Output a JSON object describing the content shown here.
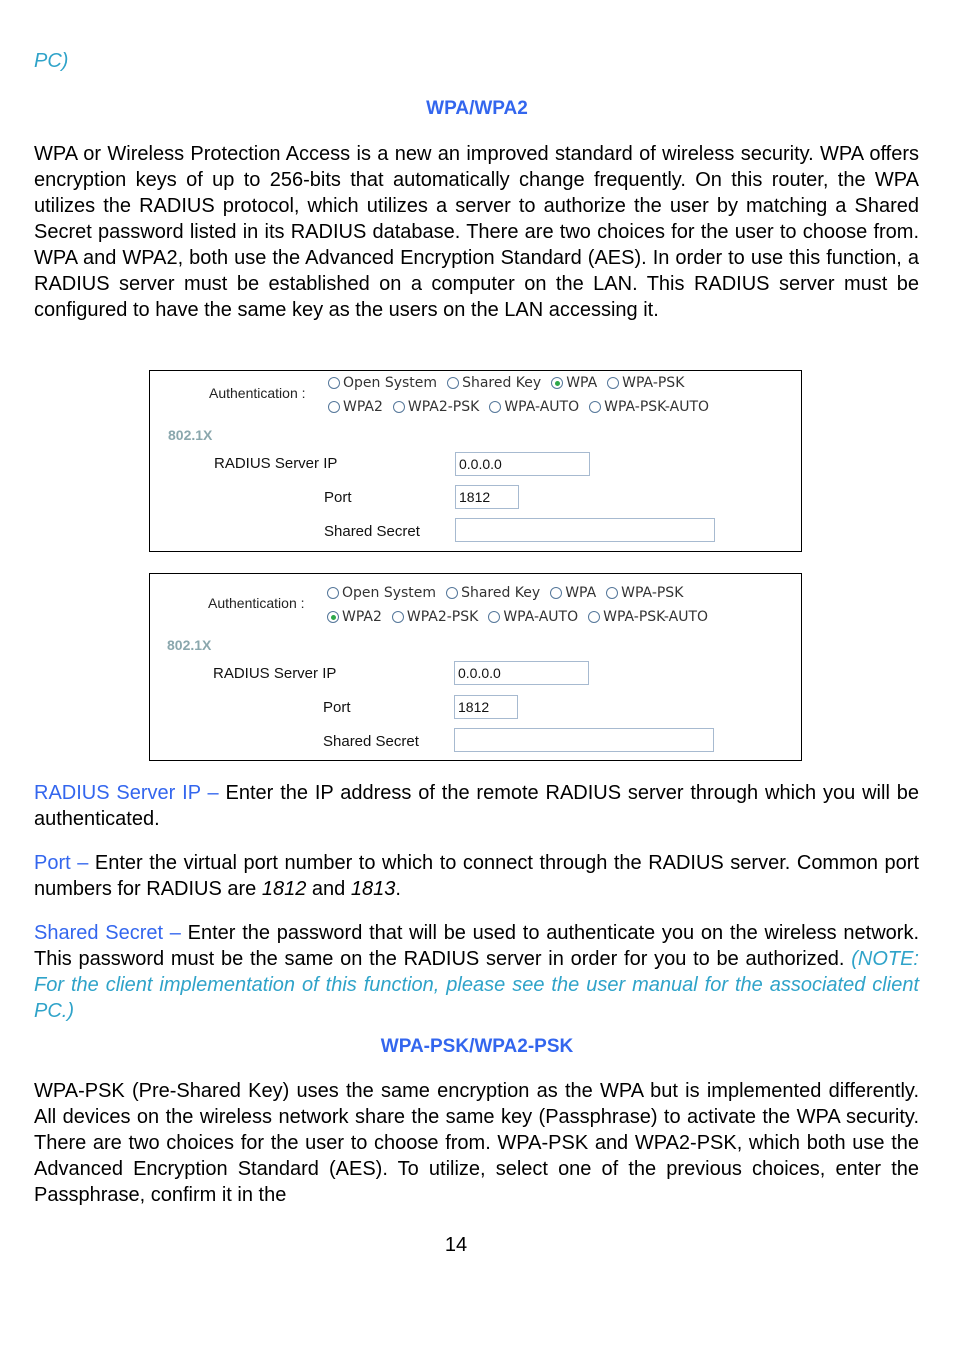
{
  "fragment_top": "PC)",
  "section1": {
    "heading": "WPA/WPA2",
    "body": "WPA or Wireless Protection Access is a new an improved standard of wireless security. WPA offers encryption keys of up to 256-bits that automatically change frequently. On this router, the WPA utilizes the RADIUS protocol, which utilizes a server to authorize the user by matching a Shared Secret password listed in its RADIUS database. There are two choices for the user to choose from. WPA and WPA2, both use the Advanced Encryption Standard (AES). In order to use this function, a RADIUS server must be established on a computer on the LAN. This RADIUS server must be configured to have the same key as the users on the LAN accessing it."
  },
  "panels": [
    {
      "auth_label": "Authentication :",
      "options_row1": [
        "Open System",
        "Shared Key",
        "WPA",
        "WPA-PSK"
      ],
      "options_row2": [
        "WPA2",
        "WPA2-PSK",
        "WPA-AUTO",
        "WPA-PSK-AUTO"
      ],
      "selected": "WPA",
      "section_label": "802.1X",
      "radius_ip_label": "RADIUS Server IP",
      "radius_ip_value": "0.0.0.0",
      "port_label": "Port",
      "port_value": "1812",
      "secret_label": "Shared Secret",
      "secret_value": ""
    },
    {
      "auth_label": "Authentication :",
      "options_row1": [
        "Open System",
        "Shared Key",
        "WPA",
        "WPA-PSK"
      ],
      "options_row2": [
        "WPA2",
        "WPA2-PSK",
        "WPA-AUTO",
        "WPA-PSK-AUTO"
      ],
      "selected": "WPA2",
      "section_label": "802.1X",
      "radius_ip_label": "RADIUS Server IP",
      "radius_ip_value": "0.0.0.0",
      "port_label": "Port",
      "port_value": "1812",
      "secret_label": "Shared Secret",
      "secret_value": ""
    }
  ],
  "definitions": {
    "radius_ip_term": "RADIUS Server IP –",
    "radius_ip_text": " Enter the IP address of the remote RADIUS server through which you will be authenticated.",
    "port_term": "Port –",
    "port_text_a": " Enter the virtual port number to which to connect through the RADIUS server. Common port numbers for RADIUS are ",
    "port_num1": "1812",
    "port_and": " and ",
    "port_num2": "1813",
    "port_end": ".",
    "secret_term": "Shared Secret –",
    "secret_text": " Enter the password that will be used to authenticate you on the wireless network. This password must be the same on the RADIUS server in order for you to be authorized. ",
    "secret_note": "(NOTE: For the client implementation of this function, please see the user manual for the associated client PC.)"
  },
  "section2": {
    "heading": "WPA-PSK/WPA2-PSK",
    "body": "WPA-PSK (Pre-Shared Key) uses the same encryption as the WPA but is implemented differently. All devices on the wireless network share the same key (Passphrase) to activate the WPA security. There are two choices for the user to choose from. WPA-PSK and WPA2-PSK, which both use the Advanced Encryption Standard (AES). To utilize, select one of the previous choices, enter the Passphrase, confirm it in the"
  },
  "page_number": "14",
  "colors": {
    "heading_blue": "#3366ee",
    "note_cyan": "#2fa3c9",
    "section_label": "#8aa7ad",
    "radio_selected": "#2ea84a",
    "input_border": "#a7bad0"
  }
}
